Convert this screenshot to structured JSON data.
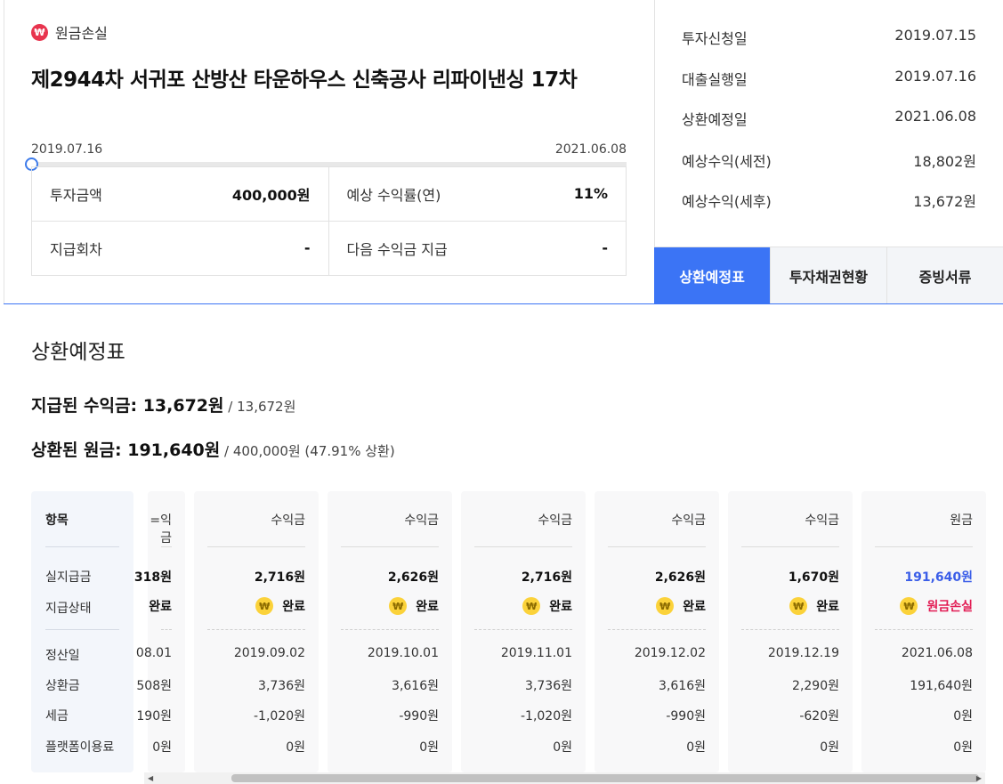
{
  "status": {
    "icon": "won-icon",
    "glyph": "₩",
    "label": "원금손실"
  },
  "title": "제2944차 서귀포 산방산 타운하우스 신축공사 리파이낸싱 17차",
  "progress": {
    "start": "2019.07.16",
    "end": "2021.06.08",
    "fraction": 0.0
  },
  "info": [
    {
      "label": "투자금액",
      "value": "400,000원"
    },
    {
      "label": "예상 수익률(연)",
      "value": "11%"
    },
    {
      "label": "지급회차",
      "value": "-"
    },
    {
      "label": "다음 수익금 지급",
      "value": "-"
    }
  ],
  "summary": [
    {
      "label": "투자신청일",
      "value": "2019.07.15"
    },
    {
      "label": "대출실행일",
      "value": "2019.07.16"
    },
    {
      "label": "상환예정일",
      "value": "2021.06.08"
    },
    {
      "label": "예상수익(세전)",
      "value": "18,802원"
    },
    {
      "label": "예상수익(세후)",
      "value": "13,672원"
    }
  ],
  "tabs": [
    {
      "label": "상환예정표",
      "active": true
    },
    {
      "label": "투자채권현황",
      "active": false
    },
    {
      "label": "증빙서류",
      "active": false
    }
  ],
  "section_title": "상환예정표",
  "paid": {
    "label": "지급된 수익금: 13,672원",
    "sub": " / 13,672원"
  },
  "repaid": {
    "label": "상환된 원금: 191,640원",
    "sub": " / 400,000원 (47.91% 상환)"
  },
  "schedule": {
    "row_labels": {
      "head": "항목",
      "actual": "실지급금",
      "state": "지급상태",
      "date": "정산일",
      "repay": "상환금",
      "tax": "세금",
      "fee": "플랫폼이용료"
    },
    "partial": {
      "type": "=익금",
      "actual": "318원",
      "state": "완료",
      "date": "08.01",
      "repay": "508원",
      "tax": "190원",
      "fee": "0원"
    },
    "columns": [
      {
        "type": "수익금",
        "actual": "2,716원",
        "state": "완료",
        "date": "2019.09.02",
        "repay": "3,736원",
        "tax": "-1,020원",
        "fee": "0원"
      },
      {
        "type": "수익금",
        "actual": "2,626원",
        "state": "완료",
        "date": "2019.10.01",
        "repay": "3,616원",
        "tax": "-990원",
        "fee": "0원"
      },
      {
        "type": "수익금",
        "actual": "2,716원",
        "state": "완료",
        "date": "2019.11.01",
        "repay": "3,736원",
        "tax": "-1,020원",
        "fee": "0원"
      },
      {
        "type": "수익금",
        "actual": "2,626원",
        "state": "완료",
        "date": "2019.12.02",
        "repay": "3,616원",
        "tax": "-990원",
        "fee": "0원"
      },
      {
        "type": "수익금",
        "actual": "1,670원",
        "state": "완료",
        "date": "2019.12.19",
        "repay": "2,290원",
        "tax": "-620원",
        "fee": "0원"
      },
      {
        "type": "원금",
        "actual": "191,640원",
        "state": "원금손실",
        "date": "2021.06.08",
        "repay": "191,640원",
        "tax": "0원",
        "fee": "0원"
      }
    ],
    "coin_glyph": "₩"
  }
}
